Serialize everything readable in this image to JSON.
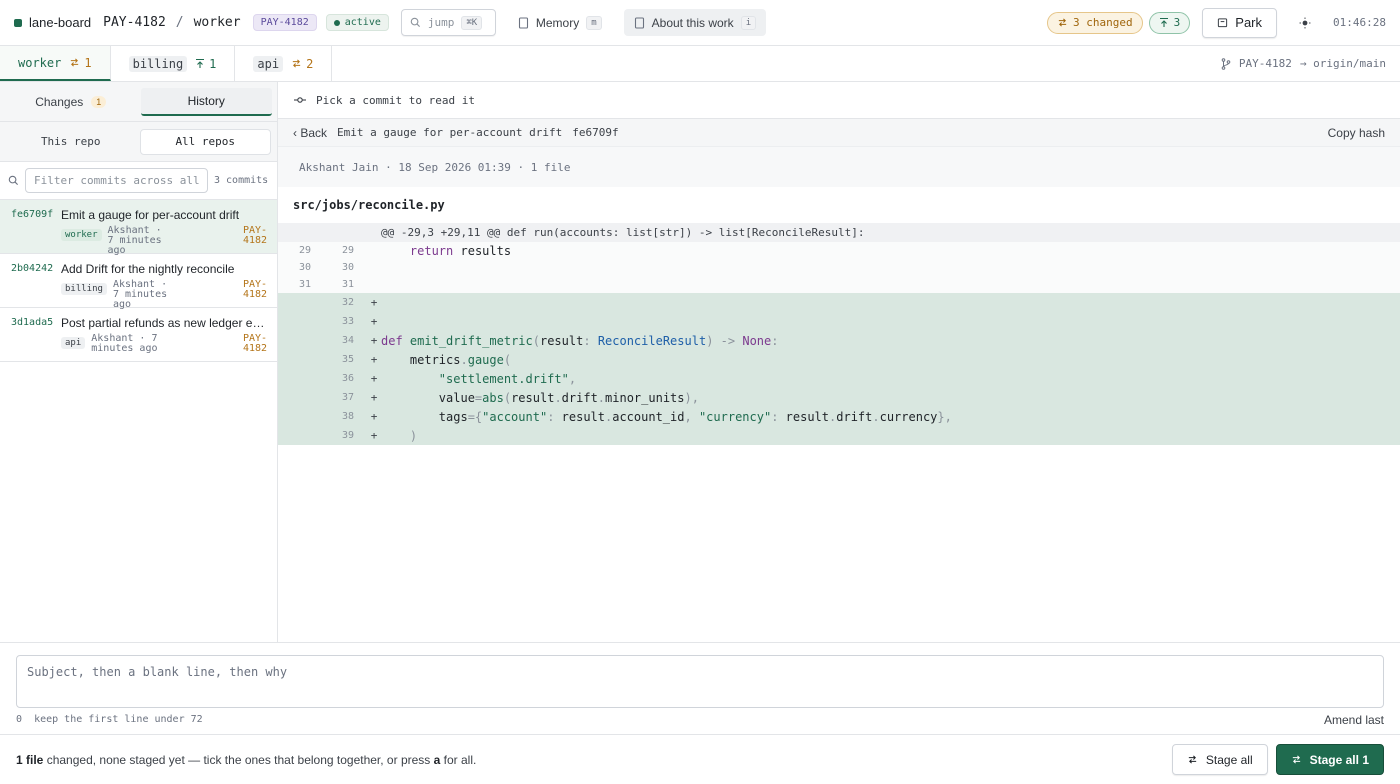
{
  "header": {
    "app_name": "lane-board",
    "ticket": "PAY-4182",
    "repo": "worker",
    "ticket_badge": "PAY-4182",
    "status": "active",
    "jump_placeholder": "jump",
    "jump_shortcut": "⌘K",
    "memory_label": "Memory",
    "memory_shortcut": "m",
    "about_label": "About this work",
    "about_shortcut": "i",
    "changed_badge": "3 changed",
    "push_badge": "3",
    "park_label": "Park",
    "clock": "01:46:28"
  },
  "repo_tabs": [
    {
      "name": "worker",
      "count": "1",
      "kind": "changes"
    },
    {
      "name": "billing",
      "count": "1",
      "kind": "push"
    },
    {
      "name": "api",
      "count": "2",
      "kind": "changes"
    }
  ],
  "branch": {
    "local": "PAY-4182",
    "remote": "→ origin/main"
  },
  "left": {
    "tab_changes": "Changes",
    "tab_changes_count": "1",
    "tab_history": "History",
    "scope_this": "This repo",
    "scope_all": "All repos",
    "filter_placeholder": "Filter commits across all",
    "commit_count": "3 commits",
    "commits": [
      {
        "hash": "fe6709f",
        "subject": "Emit a gauge for per-account drift",
        "repo": "worker",
        "author": "Akshant · 7 minutes ago",
        "ticket": "PAY-4182"
      },
      {
        "hash": "2b04242",
        "subject": "Add Drift for the nightly reconcile",
        "repo": "billing",
        "author": "Akshant · 7 minutes ago",
        "ticket": "PAY-4182"
      },
      {
        "hash": "3d1ada5",
        "subject": "Post partial refunds as new ledger entries",
        "repo": "api",
        "author": "Akshant · 7 minutes ago",
        "ticket": "PAY-4182"
      }
    ]
  },
  "detail": {
    "pick_hint": "Pick a commit to read it",
    "back_label": "Back",
    "commit_subject": "Emit a gauge for per-account drift",
    "commit_hash": "fe6709f",
    "copy_hash": "Copy hash",
    "author_line": "Akshant Jain · 18 Sep 2026 01:39 · 1 file",
    "file_path": "src/jobs/reconcile.py",
    "hunk": "@@ -29,3 +29,11 @@  def run(accounts: list[str]) -> list[ReconcileResult]:",
    "ctx_lines": [
      {
        "old": "29",
        "new": "29",
        "code": "    return results"
      },
      {
        "old": "30",
        "new": "30",
        "code": ""
      },
      {
        "old": "31",
        "new": "31",
        "code": ""
      }
    ],
    "add_line_numbers": [
      "32",
      "33",
      "34",
      "35",
      "36",
      "37",
      "38",
      "39"
    ]
  },
  "composer": {
    "placeholder": "Subject, then a blank line, then why",
    "char_count": "0",
    "hint": "keep the first line under 72",
    "amend_label": "Amend last"
  },
  "footer": {
    "file_count": "1 file",
    "text_mid": " changed, none staged yet — tick the ones that belong together, or press ",
    "key": "a",
    "text_end": " for all.",
    "stage_all": "Stage all",
    "stage_all_primary": "Stage all 1"
  },
  "colors": {
    "accent": "#1f6b4f",
    "amber": "#b4751a",
    "purple": "#5b4a9b"
  }
}
